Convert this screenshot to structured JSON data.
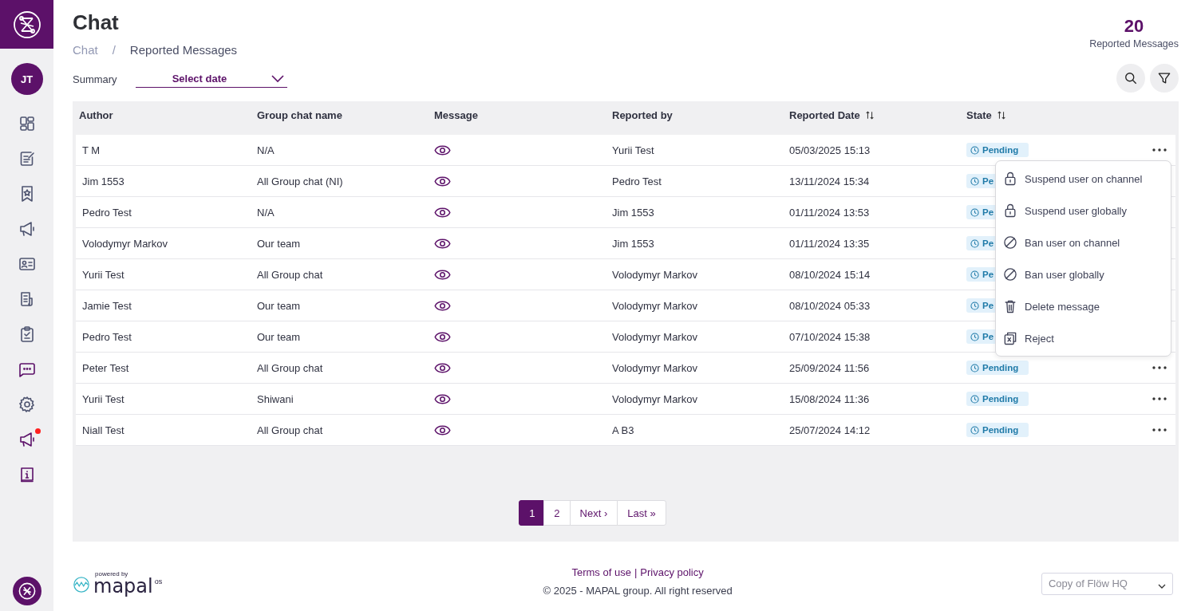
{
  "sidebar": {
    "avatar": "JT",
    "items": [
      {
        "kind": "dashboard",
        "selected": false,
        "badge": false
      },
      {
        "kind": "notes",
        "selected": false,
        "badge": false
      },
      {
        "kind": "bookmark",
        "selected": false,
        "badge": false
      },
      {
        "kind": "megaphone",
        "selected": false,
        "badge": false
      },
      {
        "kind": "idcard",
        "selected": false,
        "badge": false
      },
      {
        "kind": "document",
        "selected": false,
        "badge": false
      },
      {
        "kind": "clipboard",
        "selected": false,
        "badge": false
      },
      {
        "kind": "chat",
        "selected": true,
        "badge": false
      },
      {
        "kind": "gear",
        "selected": false,
        "badge": false
      },
      {
        "kind": "megaphone",
        "selected": true,
        "badge": true
      },
      {
        "kind": "info",
        "selected": true,
        "badge": false
      }
    ]
  },
  "header": {
    "title": "Chat",
    "breadcrumb": [
      "Chat",
      "Reported Messages"
    ],
    "breadcrumb_separator": "/",
    "counter": {
      "value": "20",
      "label": "Reported Messages"
    }
  },
  "filter": {
    "label": "Summary",
    "date_select": "Select date"
  },
  "table": {
    "columns": [
      {
        "label": "Author",
        "sortable": false
      },
      {
        "label": "Group chat name",
        "sortable": false
      },
      {
        "label": "Message",
        "sortable": false
      },
      {
        "label": "Reported by",
        "sortable": false
      },
      {
        "label": "Reported Date",
        "sortable": true
      },
      {
        "label": "State",
        "sortable": true
      }
    ],
    "rows": [
      {
        "author": "T M",
        "group": "N/A",
        "reported_by": "Yurii Test",
        "date": "05/03/2025 15:13",
        "state": "Pending"
      },
      {
        "author": "Jim 1553",
        "group": "All Group chat (NI)",
        "reported_by": "Pedro Test",
        "date": "13/11/2024 15:34",
        "state": "Pe"
      },
      {
        "author": "Pedro Test",
        "group": "N/A",
        "reported_by": "Jim 1553",
        "date": "01/11/2024 13:53",
        "state": "Pe"
      },
      {
        "author": "Volodymyr Markov",
        "group": "Our team",
        "reported_by": "Jim 1553",
        "date": "01/11/2024 13:35",
        "state": "Pe"
      },
      {
        "author": "Yurii Test",
        "group": "All Group chat",
        "reported_by": "Volodymyr Markov",
        "date": "08/10/2024 15:14",
        "state": "Pe"
      },
      {
        "author": "Jamie Test",
        "group": "Our team",
        "reported_by": "Volodymyr Markov",
        "date": "08/10/2024 05:33",
        "state": "Pe"
      },
      {
        "author": "Pedro Test",
        "group": "Our team",
        "reported_by": "Volodymyr Markov",
        "date": "07/10/2024 15:38",
        "state": "Pe"
      },
      {
        "author": "Peter Test",
        "group": "All Group chat",
        "reported_by": "Volodymyr Markov",
        "date": "25/09/2024 11:56",
        "state": "Pending"
      },
      {
        "author": "Yurii Test",
        "group": "Shiwani",
        "reported_by": "Volodymyr Markov",
        "date": "15/08/2024 11:36",
        "state": "Pending"
      },
      {
        "author": "Niall Test",
        "group": "All Group chat",
        "reported_by": "A B3",
        "date": "25/07/2024 14:12",
        "state": "Pending"
      }
    ]
  },
  "action_menu": [
    {
      "kind": "lock",
      "label": "Suspend user on channel"
    },
    {
      "kind": "lock",
      "label": "Suspend user globally"
    },
    {
      "kind": "ban",
      "label": "Ban user on channel"
    },
    {
      "kind": "ban",
      "label": "Ban user globally"
    },
    {
      "kind": "trash",
      "label": "Delete message"
    },
    {
      "kind": "reject",
      "label": "Reject"
    }
  ],
  "pagination": [
    {
      "label": "1",
      "selected": true
    },
    {
      "label": "2",
      "selected": false
    },
    {
      "label": "Next ›",
      "selected": false
    },
    {
      "label": "Last »",
      "selected": false
    }
  ],
  "footer": {
    "powered_by": "powered by",
    "brand": "mapal",
    "brand_suffix": "os",
    "links": [
      "Terms of use",
      "Privacy policy"
    ],
    "separator": "|",
    "copyright": "© 2025 - MAPAL group. All right reserved",
    "site_select": "Copy of Flöw HQ"
  }
}
